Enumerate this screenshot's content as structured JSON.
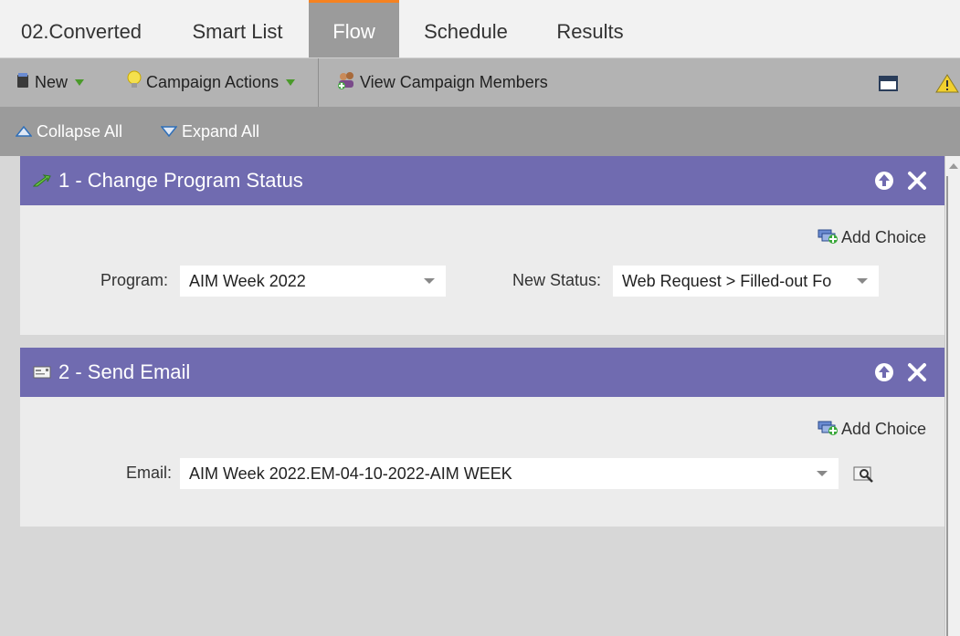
{
  "tabs": [
    {
      "label": "02.Converted"
    },
    {
      "label": "Smart List"
    },
    {
      "label": "Flow"
    },
    {
      "label": "Schedule"
    },
    {
      "label": "Results"
    }
  ],
  "active_tab": "Flow",
  "toolbar": {
    "new_label": "New",
    "campaign_actions_label": "Campaign Actions",
    "view_members_label": "View Campaign Members"
  },
  "subbar": {
    "collapse_label": "Collapse All",
    "expand_label": "Expand All"
  },
  "flow_steps": [
    {
      "title": "1 - Change Program Status",
      "add_choice_label": "Add Choice",
      "program_label": "Program:",
      "program_value": "AIM Week 2022",
      "status_label": "New Status:",
      "status_value": "Web Request > Filled-out Fo"
    },
    {
      "title": "2 - Send Email",
      "add_choice_label": "Add Choice",
      "email_label": "Email:",
      "email_value": "AIM Week 2022.EM-04-10-2022-AIM WEEK"
    }
  ],
  "colors": {
    "accent_tab": "#f58221",
    "step_header": "#706bb0",
    "toolbar_bg": "#b3b3b3",
    "subbar_bg": "#9b9b9b"
  }
}
